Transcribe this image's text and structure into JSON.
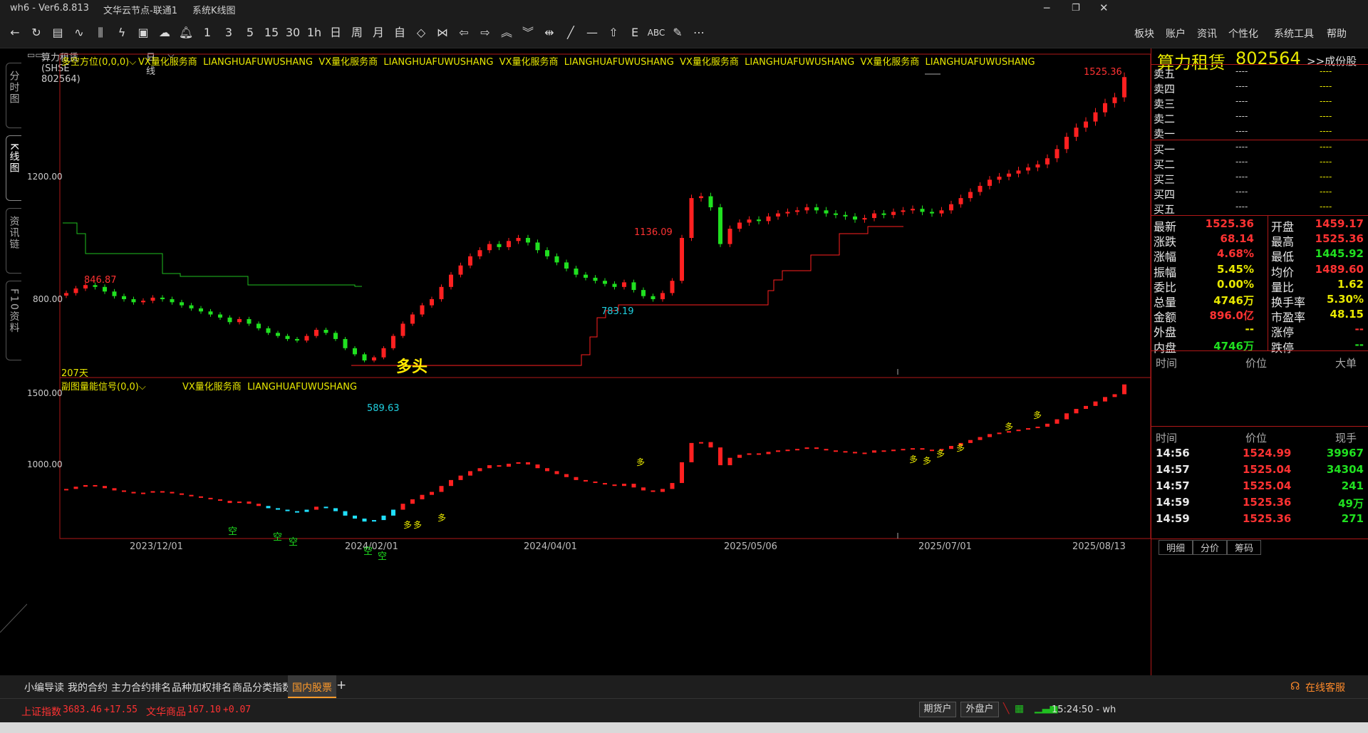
{
  "titlebar": {
    "app": "wh6  -  Ver6.8.813",
    "server": "文华云节点-联通1",
    "window": "系统K线图"
  },
  "toolbar": {
    "icons": [
      "back-icon",
      "refresh-icon",
      "table-icon",
      "line-chart-icon",
      "candle-icon",
      "indicator-icon",
      "quote-icon",
      "cloud-icon",
      "bell-icon"
    ],
    "periods": [
      "1",
      "3",
      "5",
      "15",
      "30",
      "1h",
      "日",
      "周",
      "月",
      "自"
    ],
    "tools_text": [
      "ABC"
    ],
    "menu": [
      "板块",
      "账户",
      "资讯",
      "个性化",
      "系统工具",
      "帮助"
    ]
  },
  "sidetabs": [
    "分时图",
    "K线图",
    "资讯链",
    "F10资料"
  ],
  "chart": {
    "symbol_label": "算力租赁(SHSE 802564)",
    "period_label": "日线",
    "main_indicator": "多空方位(0,0,0)",
    "ad_text": "VX量化服务商  LIANGHUAFUWUSHANG  VX量化服务商  LIANGHUAFUWUSHANG  VX量化服务商  LIANGHUAFUWUSHANG  VX量化服务商  LIANGHUAFUWUSHANG  VX量化服务商  LIANGHUAFUWUSHANG",
    "y_ticks_main": [
      "1200.00",
      "800.00"
    ],
    "high_label": "1525.36",
    "mid_high_label": "1136.09",
    "left_high_label": "846.87",
    "low_label": "589.63",
    "mid_low_label": "783.19",
    "days_label": "207天",
    "signal_label": "多头",
    "sub_indicator": "副图量能信号(0,0)",
    "sub_ad_text": "VX量化服务商  LIANGHUAFUWUSHANG",
    "y_ticks_sub": [
      "1500.00",
      "1000.00"
    ],
    "x_ticks": [
      "2023/12/01",
      "2024/02/01",
      "2024/04/01",
      "2025/05/06",
      "2025/07/01",
      "2025/08/13"
    ],
    "sub_signals_kong": [
      "空",
      "空",
      "空",
      "空",
      "空"
    ],
    "sub_signals_duo": [
      "多",
      "多",
      "多",
      "多",
      "多",
      "多",
      "多",
      "多",
      "多",
      "多"
    ]
  },
  "chart_data": {
    "type": "candlestick",
    "series_main_closes": [
      820,
      835,
      846,
      840,
      825,
      810,
      800,
      790,
      795,
      805,
      800,
      790,
      780,
      770,
      760,
      750,
      740,
      725,
      735,
      720,
      705,
      690,
      680,
      670,
      665,
      680,
      700,
      690,
      670,
      640,
      620,
      600,
      610,
      640,
      680,
      720,
      750,
      780,
      800,
      840,
      880,
      910,
      940,
      960,
      980,
      970,
      990,
      1000,
      985,
      960,
      940,
      920,
      900,
      880,
      870,
      860,
      850,
      840,
      855,
      830,
      810,
      800,
      820,
      860,
      1000,
      1130,
      1136,
      1100,
      980,
      1030,
      1050,
      1060,
      1055,
      1070,
      1080,
      1085,
      1090,
      1100,
      1090,
      1080,
      1075,
      1070,
      1060,
      1065,
      1080,
      1075,
      1085,
      1090,
      1095,
      1085,
      1080,
      1090,
      1110,
      1130,
      1150,
      1170,
      1190,
      1200,
      1210,
      1220,
      1230,
      1240,
      1260,
      1290,
      1330,
      1360,
      1380,
      1410,
      1440,
      1459,
      1525
    ],
    "latest": 1525.36,
    "support_line_note": "多空方位"
  },
  "rightpanel": {
    "name": "算力租赁",
    "code": "802564",
    "link": ">>成份股",
    "sell_labels": [
      "卖五",
      "卖四",
      "卖三",
      "卖二",
      "卖一"
    ],
    "buy_labels": [
      "买一",
      "买二",
      "买三",
      "买四",
      "买五"
    ],
    "dash": "----",
    "stats": [
      {
        "l": "最新",
        "v": "1525.36",
        "c": "red",
        "l2": "开盘",
        "v2": "1459.17",
        "c2": "red"
      },
      {
        "l": "涨跌",
        "v": "68.14",
        "c": "red",
        "l2": "最高",
        "v2": "1525.36",
        "c2": "red"
      },
      {
        "l": "涨幅",
        "v": "4.68%",
        "c": "red",
        "l2": "最低",
        "v2": "1445.92",
        "c2": "green"
      },
      {
        "l": "振幅",
        "v": "5.45%",
        "c": "yellow",
        "l2": "均价",
        "v2": "1489.60",
        "c2": "red"
      },
      {
        "l": "委比",
        "v": "0.00%",
        "c": "yellow",
        "l2": "量比",
        "v2": "1.62",
        "c2": "yellow"
      },
      {
        "l": "总量",
        "v": "4746万",
        "c": "yellow",
        "l2": "换手率",
        "v2": "5.30%",
        "c2": "yellow"
      },
      {
        "l": "金额",
        "v": "896.0亿",
        "c": "red",
        "l2": "市盈率",
        "v2": "48.15",
        "c2": "yellow"
      },
      {
        "l": "外盘",
        "v": "--",
        "c": "yellow",
        "l2": "涨停",
        "v2": "--",
        "c2": "red"
      },
      {
        "l": "内盘",
        "v": "4746万",
        "c": "green",
        "l2": "跌停",
        "v2": "--",
        "c2": "green"
      }
    ],
    "bigorder_header": [
      "时间",
      "价位",
      "大单"
    ],
    "ticks_header": [
      "时间",
      "价位",
      "现手"
    ],
    "ticks": [
      {
        "t": "14:56",
        "p": "1524.99",
        "q": "39967"
      },
      {
        "t": "14:57",
        "p": "1525.04",
        "q": "34304"
      },
      {
        "t": "14:57",
        "p": "1525.04",
        "q": "241"
      },
      {
        "t": "14:59",
        "p": "1525.36",
        "q": "49万"
      },
      {
        "t": "14:59",
        "p": "1525.36",
        "q": "271"
      }
    ],
    "bottom_tabs": [
      "明细",
      "分价",
      "筹码"
    ]
  },
  "bottomtabs": [
    "小编导读",
    "我的合约",
    "主力合约排名",
    "品种加权排名",
    "商品分类指数",
    "国内股票",
    "+"
  ],
  "online_service": "在线客服",
  "status": {
    "idx1_name": "上证指数",
    "idx1_val": "3683.46",
    "idx1_chg": "+17.55",
    "idx2_name": "文华商品",
    "idx2_val": "167.10",
    "idx2_chg": "+0.07",
    "btn1": "期货户",
    "btn2": "外盘户",
    "time": "15:24:50 - wh"
  }
}
